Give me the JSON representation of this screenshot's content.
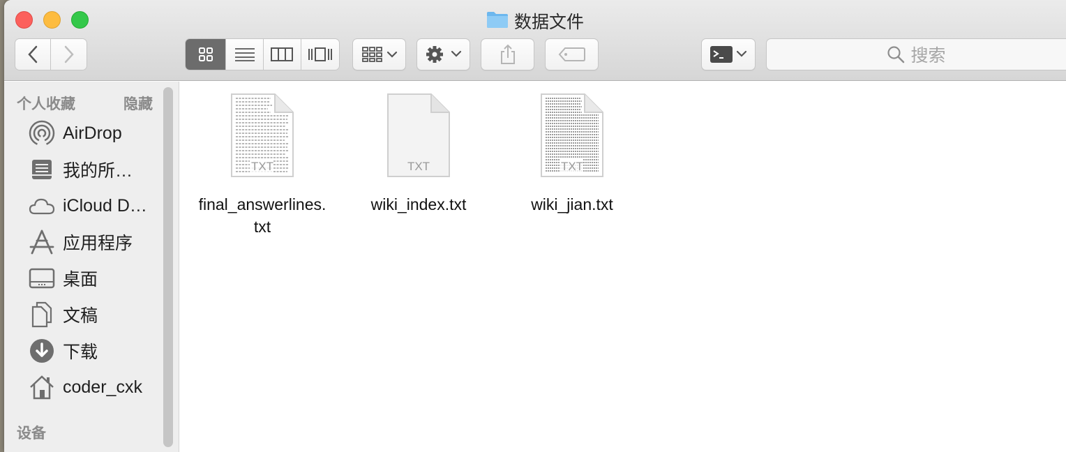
{
  "window": {
    "title": "数据文件"
  },
  "toolbar": {
    "view_modes": [
      "icon",
      "list",
      "column",
      "cover-flow"
    ],
    "active_view": "icon",
    "search_placeholder": "搜索"
  },
  "sidebar": {
    "favorites_header": "个人收藏",
    "hide_label": "隐藏",
    "items": [
      {
        "label": "AirDrop",
        "icon": "airdrop-icon"
      },
      {
        "label": "我的所…",
        "icon": "all-files-icon"
      },
      {
        "label": "iCloud D…",
        "icon": "icloud-icon"
      },
      {
        "label": "应用程序",
        "icon": "applications-icon"
      },
      {
        "label": "桌面",
        "icon": "desktop-icon"
      },
      {
        "label": "文稿",
        "icon": "documents-icon"
      },
      {
        "label": "下载",
        "icon": "downloads-icon"
      },
      {
        "label": "coder_cxk",
        "icon": "home-icon"
      }
    ],
    "devices_header": "设备"
  },
  "files": [
    {
      "name": "final_answerlines.\ntxt",
      "name_line1": "final_answerlines.",
      "name_line2": "txt",
      "badge": "TXT",
      "has_text_preview": true
    },
    {
      "name": "wiki_index.txt",
      "name_line1": "wiki_index.txt",
      "name_line2": "",
      "badge": "TXT",
      "has_text_preview": false
    },
    {
      "name": "wiki_jian.txt",
      "name_line1": "wiki_jian.txt",
      "name_line2": "",
      "badge": "TXT",
      "has_text_preview": true
    }
  ],
  "colors": {
    "close": "#fc605c",
    "minimize": "#fdbc40",
    "maximize": "#34c84a",
    "folder": "#6cb7ee",
    "sidebar_bg": "#eeeeee"
  }
}
